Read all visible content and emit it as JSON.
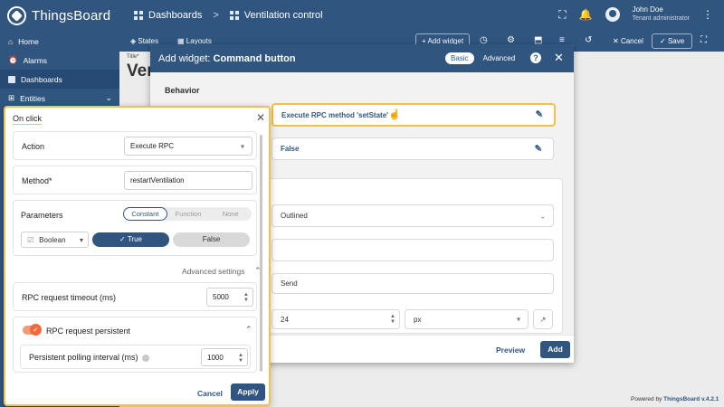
{
  "app": {
    "name": "ThingsBoard"
  },
  "breadcrumb": {
    "dashboards": "Dashboards",
    "separator": ">",
    "current": "Ventilation control"
  },
  "user": {
    "name": "John Doe",
    "role": "Tenant administrator"
  },
  "sidebar": {
    "items": [
      {
        "label": "Home",
        "icon": "home-icon"
      },
      {
        "label": "Alarms",
        "icon": "alarm-icon"
      },
      {
        "label": "Dashboards",
        "icon": "dashboards-icon"
      },
      {
        "label": "Entities",
        "icon": "entities-icon",
        "chevron": "⌄"
      }
    ]
  },
  "toolbar": {
    "states": "States",
    "layouts": "Layouts",
    "add_widget": "+ Add widget",
    "cancel": "Cancel",
    "save": "Save"
  },
  "behind": {
    "title_label": "Title*",
    "title_value": "Ver"
  },
  "dialog": {
    "title_prefix": "Add widget:",
    "title_widget": "Command button",
    "mode_basic": "Basic",
    "mode_advanced": "Advanced",
    "section_behavior": "Behavior",
    "on_click_value": "Execute RPC method 'setState'",
    "disabled_value": "False",
    "button_style": "Outlined",
    "label_value": "Send",
    "font_size": "24",
    "font_unit": "px",
    "preview": "Preview",
    "add": "Add"
  },
  "onclick_popup": {
    "title": "On click",
    "action_label": "Action",
    "action_value": "Execute RPC",
    "method_label": "Method*",
    "method_value": "restartVentilation",
    "parameters_label": "Parameters",
    "param_modes": [
      "Constant",
      "Function",
      "None"
    ],
    "param_mode_selected": "Constant",
    "type_value": "Boolean",
    "true_label": "True",
    "false_label": "False",
    "selected_boolean": "True",
    "advanced_settings": "Advanced settings",
    "timeout_label": "RPC request timeout (ms)",
    "timeout_value": "5000",
    "persistent_label": "RPC request persistent",
    "persistent_enabled": true,
    "polling_label": "Persistent polling interval (ms)",
    "polling_value": "1000",
    "cancel": "Cancel",
    "apply": "Apply"
  },
  "footer": {
    "powered_prefix": "Powered by",
    "powered_brand": "ThingsBoard v.4.2.1"
  },
  "colors": {
    "primary": "#305680",
    "highlight": "#f2c14b",
    "toggle_on": "#ef6a3b"
  }
}
